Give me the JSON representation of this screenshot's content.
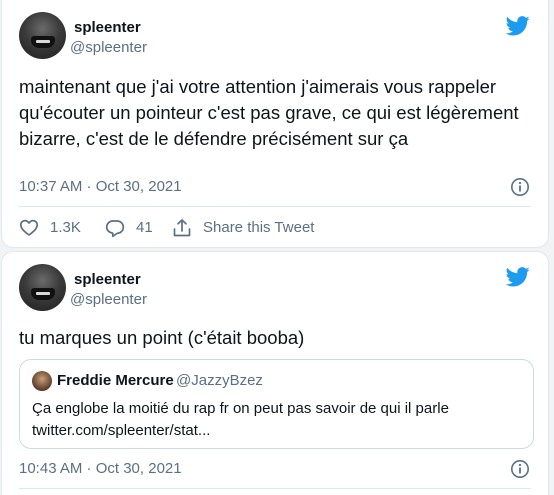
{
  "tweets": [
    {
      "author_name": "spleenter",
      "author_handle": "@spleenter",
      "text": "maintenant que j'ai votre attention j'aimerais vous rappeler qu'écouter un pointeur c'est pas grave, ce qui est légèrement bizarre, c'est de le défendre précisément sur ça",
      "timestamp": "10:37 AM · Oct 30, 2021",
      "likes": "1.3K",
      "replies": "41",
      "share_label": "Share this Tweet"
    },
    {
      "author_name": "spleenter",
      "author_handle": "@spleenter",
      "text": "tu marques un point (c'était booba)",
      "timestamp": "10:43 AM · Oct 30, 2021",
      "quote": {
        "author_name": "Freddie Mercure",
        "author_handle": "@JazzyBzez",
        "text_line1": "Ça englobe la moitié du rap fr on peut pas savoir de qui il parle",
        "text_line2": "twitter.com/spleenter/stat..."
      }
    }
  ],
  "icons": [
    "twitter-bird-icon",
    "info-icon",
    "heart-icon",
    "reply-icon",
    "share-icon"
  ],
  "colors": {
    "brand": "#1d9bf0",
    "secondary_text": "#5b7083",
    "border": "#e1e8ed"
  }
}
